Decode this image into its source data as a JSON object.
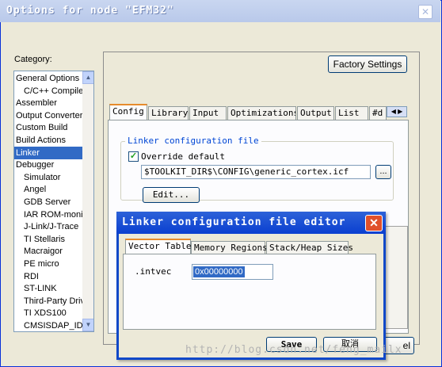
{
  "window": {
    "title": "Options for node \"EFM32\"",
    "close": "✕"
  },
  "category": {
    "label": "Category:",
    "items": [
      {
        "label": "General Options"
      },
      {
        "label": "C/C++ Compiler"
      },
      {
        "label": "Assembler"
      },
      {
        "label": "Output Converter"
      },
      {
        "label": "Custom Build"
      },
      {
        "label": "Build Actions"
      },
      {
        "label": "Linker"
      },
      {
        "label": "Debugger"
      },
      {
        "label": "Simulator"
      },
      {
        "label": "Angel"
      },
      {
        "label": "GDB Server"
      },
      {
        "label": "IAR ROM-monitor"
      },
      {
        "label": "J-Link/J-Trace"
      },
      {
        "label": "TI Stellaris"
      },
      {
        "label": "Macraigor"
      },
      {
        "label": "PE micro"
      },
      {
        "label": "RDI"
      },
      {
        "label": "ST-LINK"
      },
      {
        "label": "Third-Party Driver"
      },
      {
        "label": "TI XDS100"
      },
      {
        "label": "CMSISDAP_ID"
      }
    ],
    "selected": "Linker"
  },
  "factory_settings": "Factory Settings",
  "tabs": [
    "Config",
    "Library",
    "Input",
    "Optimizations",
    "Output",
    "List",
    "#d"
  ],
  "active_tab": "Config",
  "linker_config": {
    "group_title": "Linker configuration file",
    "override_label": "Override default",
    "override_checked": true,
    "path": "$TOOLKIT_DIR$\\CONFIG\\generic_cortex.icf",
    "browse": "...",
    "edit": "Edit..."
  },
  "dialog": {
    "title": "Linker configuration file editor",
    "tabs": [
      "Vector Table",
      "Memory Regions",
      "Stack/Heap Sizes"
    ],
    "active_tab": "Vector Table",
    "intvec_label": ".intvec",
    "intvec_value": "0x00000000",
    "save": "Save",
    "cancel": "取消"
  },
  "behind_cancel": "el",
  "watermark": "http://blog.csdn.net/feng_mailx"
}
